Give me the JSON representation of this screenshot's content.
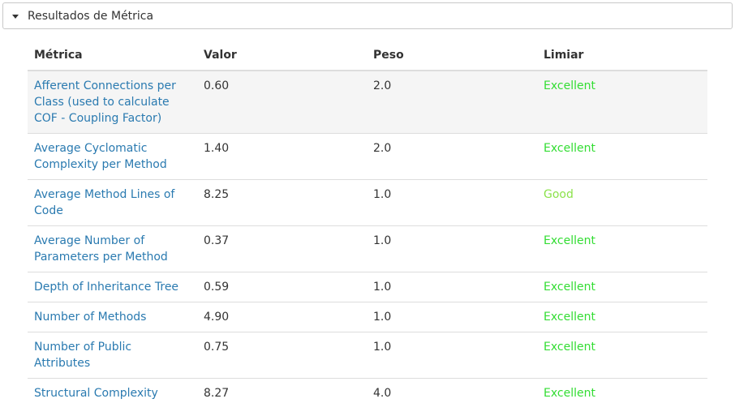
{
  "panel": {
    "title": "Resultados de Métrica"
  },
  "table": {
    "headers": {
      "metric": "Métrica",
      "value": "Valor",
      "weight": "Peso",
      "threshold": "Limiar"
    },
    "rows": [
      {
        "metric": "Afferent Connections per Class (used to calculate COF - Coupling Factor)",
        "value": "0.60",
        "weight": "2.0",
        "threshold": "Excellent",
        "threshold_color": "#33dd33"
      },
      {
        "metric": "Average Cyclomatic Complexity per Method",
        "value": "1.40",
        "weight": "2.0",
        "threshold": "Excellent",
        "threshold_color": "#33dd33"
      },
      {
        "metric": "Average Method Lines of Code",
        "value": "8.25",
        "weight": "1.0",
        "threshold": "Good",
        "threshold_color": "#8be24a"
      },
      {
        "metric": "Average Number of Parameters per Method",
        "value": "0.37",
        "weight": "1.0",
        "threshold": "Excellent",
        "threshold_color": "#33dd33"
      },
      {
        "metric": "Depth of Inheritance Tree",
        "value": "0.59",
        "weight": "1.0",
        "threshold": "Excellent",
        "threshold_color": "#33dd33"
      },
      {
        "metric": "Number of Methods",
        "value": "4.90",
        "weight": "1.0",
        "threshold": "Excellent",
        "threshold_color": "#33dd33"
      },
      {
        "metric": "Number of Public Attributes",
        "value": "0.75",
        "weight": "1.0",
        "threshold": "Excellent",
        "threshold_color": "#33dd33"
      },
      {
        "metric": "Structural Complexity",
        "value": "8.27",
        "weight": "4.0",
        "threshold": "Excellent",
        "threshold_color": "#33dd33"
      }
    ]
  },
  "colors": {
    "link": "#2a7ab0",
    "excellent": "#33dd33",
    "good": "#8be24a",
    "highlight_row": "#f5f5f5"
  }
}
